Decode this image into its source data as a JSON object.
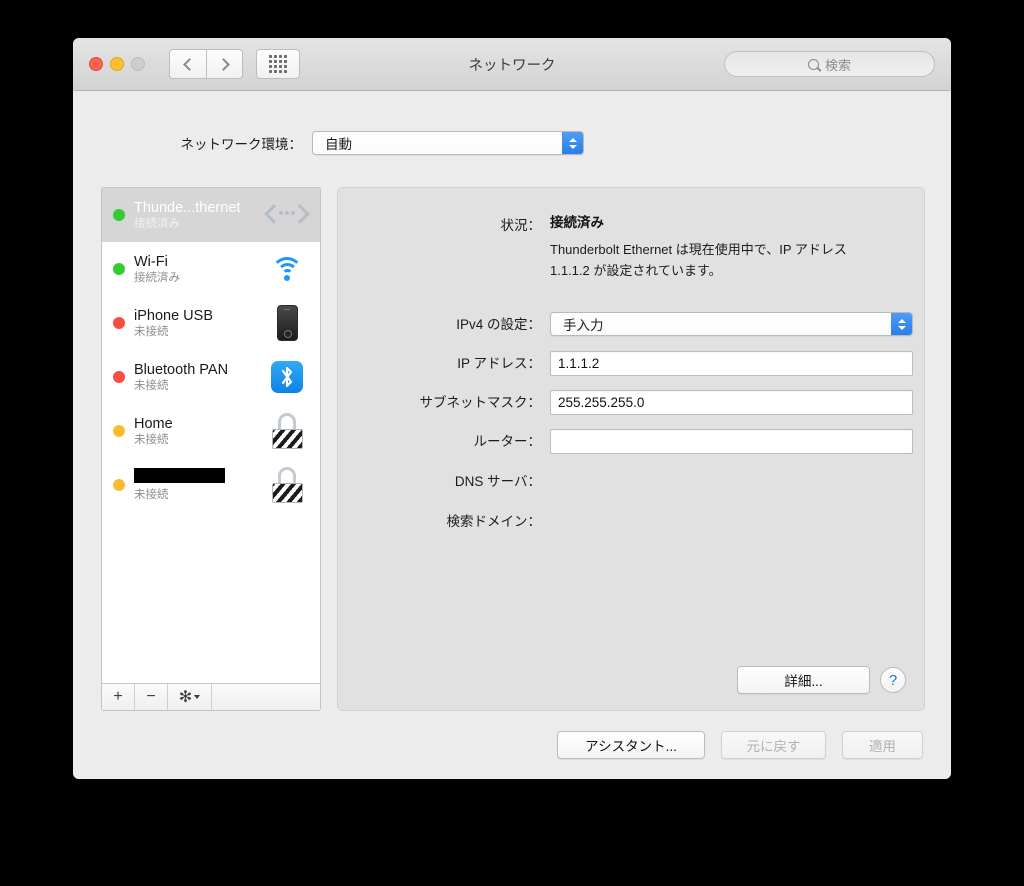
{
  "window": {
    "title": "ネットワーク",
    "traffic_lights": [
      "close",
      "minimize",
      "zoom"
    ],
    "colors": {
      "accent_blue": "#2b7de8",
      "status_connected": "#31cd32",
      "status_disconnected": "#fb4c42",
      "status_inactive": "#fcbb2e",
      "titlebar": "#d3d3d3",
      "panel_bg": "#e1e1e1",
      "selection": "#d6d6d6"
    }
  },
  "toolbar": {
    "back_icon": "chevron-left-icon",
    "forward_icon": "chevron-right-icon",
    "showall_icon": "grid-icon",
    "search_placeholder": "検索",
    "search_value": "",
    "search_icon": "search-icon"
  },
  "location": {
    "label": "ネットワーク環境：",
    "selected": "自動"
  },
  "sidebar": {
    "services": [
      {
        "name": "Thunde...thernet",
        "status": "接続済み",
        "dot": "green",
        "icon": "thunderbolt-icon",
        "selected": true
      },
      {
        "name": "Wi-Fi",
        "status": "接続済み",
        "dot": "green",
        "icon": "wifi-icon",
        "selected": false
      },
      {
        "name": "iPhone USB",
        "status": "未接続",
        "dot": "red",
        "icon": "iphone-icon",
        "selected": false
      },
      {
        "name": "Bluetooth PAN",
        "status": "未接続",
        "dot": "red",
        "icon": "bluetooth-icon",
        "selected": false
      },
      {
        "name": "Home",
        "status": "未接続",
        "dot": "orange",
        "icon": "lock-icon",
        "selected": false
      },
      {
        "name": "",
        "status": "未接続",
        "dot": "orange",
        "icon": "lock-icon",
        "selected": false,
        "redacted": true
      }
    ],
    "toolbar": {
      "add_label": "+",
      "remove_label": "−",
      "gear_label": "✻"
    }
  },
  "detail": {
    "status_label": "状況：",
    "status_value": "接続済み",
    "status_description": "Thunderbolt Ethernet は現在使用中で、IP アドレス 1.1.1.2 が設定されています。",
    "ipv4_label": "IPv4 の設定：",
    "ipv4_value": "手入力",
    "ip_label": "IP アドレス：",
    "ip_value": "1.1.1.2",
    "subnet_label": "サブネットマスク：",
    "subnet_value": "255.255.255.0",
    "router_label": "ルーター：",
    "router_value": "",
    "dns_label": "DNS サーバ：",
    "dns_value": "",
    "search_domain_label": "検索ドメイン：",
    "search_domain_value": "",
    "advanced_label": "詳細...",
    "help_label": "?"
  },
  "footer": {
    "assistant_label": "アシスタント...",
    "revert_label": "元に戻す",
    "apply_label": "適用"
  }
}
